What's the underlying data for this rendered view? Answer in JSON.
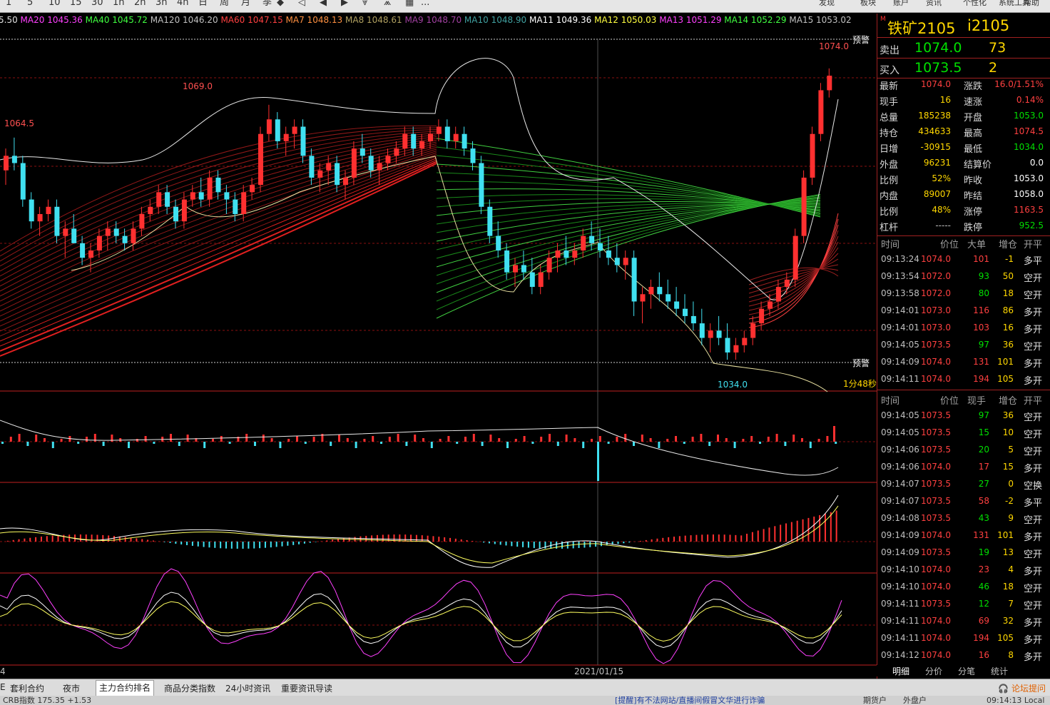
{
  "toolbar": {
    "periods": [
      "1",
      "5",
      "10",
      "15",
      "30",
      "1h",
      "2h",
      "3h",
      "4h",
      "日",
      "周",
      "月",
      "季"
    ],
    "menus": [
      "发现",
      "板块",
      "账户",
      "资讯",
      "个性化",
      "系统工具",
      "帮助"
    ],
    "more": "..."
  },
  "ma_legend": [
    {
      "label": "5.50",
      "color": "#e0e0e0"
    },
    {
      "label": "MA20",
      "value": "1045.36",
      "color": "#ff40ff"
    },
    {
      "label": "MA40",
      "value": "1045.72",
      "color": "#40ff40"
    },
    {
      "label": "MA120",
      "value": "1046.20",
      "color": "#c0c0c0"
    },
    {
      "label": "MA60",
      "value": "1047.15",
      "color": "#ff4040"
    },
    {
      "label": "MA7",
      "value": "1048.13",
      "color": "#ff9040"
    },
    {
      "label": "MA8",
      "value": "1048.61",
      "color": "#b0a060"
    },
    {
      "label": "MA9",
      "value": "1048.70",
      "color": "#a040a0"
    },
    {
      "label": "MA10",
      "value": "1048.90",
      "color": "#40a0a0"
    },
    {
      "label": "MA11",
      "value": "1049.36",
      "color": "#ffffff"
    },
    {
      "label": "MA12",
      "value": "1050.03",
      "color": "#ffff40"
    },
    {
      "label": "MA13",
      "value": "1051.29",
      "color": "#ff40ff"
    },
    {
      "label": "MA14",
      "value": "1052.29",
      "color": "#40ff40"
    },
    {
      "label": "MA15",
      "value": "1053.02",
      "color": "#c0c0c0"
    }
  ],
  "chart_labels": {
    "high_1064": "1064.5",
    "high_1069": "1069.0",
    "high_last": "1074.0",
    "low": "1034.0",
    "alert_top": "预警",
    "alert_bottom": "预警",
    "countdown": "1分48秒",
    "date": "2021/01/15",
    "left_axis_digit": "4"
  },
  "colors": {
    "up": "#ff3030",
    "down": "#40e0f0",
    "bg": "#000000",
    "grid": "#8a1010",
    "border": "#c02020",
    "gold": "#ffd700",
    "green": "#00e000",
    "white": "#ffffff"
  },
  "chart_data": {
    "type": "candlestick",
    "symbol": "铁矿2105",
    "ylim": [
      1030,
      1078
    ],
    "labeled_high": 1074.0,
    "labeled_low": 1034.0,
    "x_date_label": "2021/01/15",
    "candles": [
      [
        1060,
        1063,
        1058,
        1062
      ],
      [
        1062,
        1064.5,
        1060,
        1061
      ],
      [
        1061,
        1062,
        1055,
        1056
      ],
      [
        1056,
        1057,
        1052,
        1053
      ],
      [
        1053,
        1055,
        1051,
        1054
      ],
      [
        1054,
        1056,
        1053,
        1055
      ],
      [
        1055,
        1056,
        1050,
        1051
      ],
      [
        1051,
        1053,
        1048,
        1052
      ],
      [
        1052,
        1054,
        1050,
        1050
      ],
      [
        1050,
        1051,
        1047,
        1048
      ],
      [
        1048,
        1050,
        1046,
        1049
      ],
      [
        1049,
        1052,
        1048,
        1051
      ],
      [
        1051,
        1053,
        1049,
        1052
      ],
      [
        1052,
        1053,
        1050,
        1051
      ],
      [
        1051,
        1052,
        1049,
        1050
      ],
      [
        1050,
        1053,
        1049,
        1052
      ],
      [
        1052,
        1055,
        1051,
        1054
      ],
      [
        1054,
        1056,
        1053,
        1055
      ],
      [
        1055,
        1058,
        1054,
        1057
      ],
      [
        1057,
        1058,
        1054,
        1055
      ],
      [
        1055,
        1056,
        1052,
        1053
      ],
      [
        1053,
        1057,
        1052,
        1056
      ],
      [
        1056,
        1058,
        1055,
        1057
      ],
      [
        1057,
        1059,
        1055,
        1056
      ],
      [
        1056,
        1060,
        1055,
        1059
      ],
      [
        1059,
        1060,
        1056,
        1057
      ],
      [
        1057,
        1058,
        1054,
        1056
      ],
      [
        1056,
        1057,
        1053,
        1054
      ],
      [
        1054,
        1058,
        1053,
        1057
      ],
      [
        1057,
        1059,
        1056,
        1058
      ],
      [
        1058,
        1066,
        1057,
        1065
      ],
      [
        1065,
        1069,
        1064,
        1067
      ],
      [
        1067,
        1068,
        1063,
        1064
      ],
      [
        1064,
        1066,
        1062,
        1065
      ],
      [
        1065,
        1067,
        1063,
        1066
      ],
      [
        1066,
        1067,
        1061,
        1062
      ],
      [
        1062,
        1063,
        1058,
        1059
      ],
      [
        1059,
        1061,
        1057,
        1060
      ],
      [
        1060,
        1062,
        1058,
        1061
      ],
      [
        1061,
        1062,
        1057,
        1058
      ],
      [
        1058,
        1060,
        1056,
        1059
      ],
      [
        1059,
        1064,
        1058,
        1063
      ],
      [
        1063,
        1065,
        1061,
        1062
      ],
      [
        1062,
        1063,
        1059,
        1060
      ],
      [
        1060,
        1062,
        1058,
        1061
      ],
      [
        1061,
        1063,
        1060,
        1062
      ],
      [
        1062,
        1064,
        1061,
        1063
      ],
      [
        1063,
        1066,
        1062,
        1065
      ],
      [
        1065,
        1066,
        1062,
        1063
      ],
      [
        1063,
        1065,
        1062,
        1064
      ],
      [
        1064,
        1066,
        1063,
        1065
      ],
      [
        1065,
        1067,
        1064,
        1066
      ],
      [
        1066,
        1067,
        1063,
        1064
      ],
      [
        1064,
        1066,
        1063,
        1065
      ],
      [
        1065,
        1066,
        1062,
        1063
      ],
      [
        1063,
        1064,
        1060,
        1061
      ],
      [
        1061,
        1062,
        1054,
        1055
      ],
      [
        1055,
        1056,
        1050,
        1051
      ],
      [
        1051,
        1053,
        1048,
        1049
      ],
      [
        1049,
        1050,
        1045,
        1046
      ],
      [
        1046,
        1048,
        1044,
        1047
      ],
      [
        1047,
        1049,
        1045,
        1046
      ],
      [
        1046,
        1048,
        1043,
        1044
      ],
      [
        1044,
        1047,
        1043,
        1046
      ],
      [
        1046,
        1049,
        1045,
        1048
      ],
      [
        1048,
        1050,
        1046,
        1049
      ],
      [
        1049,
        1051,
        1047,
        1048
      ],
      [
        1048,
        1050,
        1047,
        1049
      ],
      [
        1049,
        1052,
        1048,
        1051
      ],
      [
        1051,
        1053,
        1049,
        1050
      ],
      [
        1050,
        1052,
        1048,
        1049
      ],
      [
        1049,
        1051,
        1047,
        1048
      ],
      [
        1048,
        1050,
        1046,
        1047
      ],
      [
        1047,
        1049,
        1045,
        1048
      ],
      [
        1048,
        1049,
        1040,
        1042
      ],
      [
        1042,
        1044,
        1039,
        1043
      ],
      [
        1043,
        1045,
        1041,
        1044
      ],
      [
        1044,
        1046,
        1042,
        1043
      ],
      [
        1043,
        1045,
        1041,
        1042
      ],
      [
        1042,
        1044,
        1040,
        1041
      ],
      [
        1041,
        1043,
        1039,
        1040
      ],
      [
        1040,
        1042,
        1038,
        1039
      ],
      [
        1039,
        1041,
        1036,
        1037
      ],
      [
        1037,
        1039,
        1035,
        1038
      ],
      [
        1038,
        1040,
        1036,
        1037
      ],
      [
        1037,
        1039,
        1034,
        1035
      ],
      [
        1035,
        1037,
        1034,
        1036
      ],
      [
        1036,
        1038,
        1035,
        1037
      ],
      [
        1037,
        1040,
        1036,
        1039
      ],
      [
        1039,
        1042,
        1038,
        1041
      ],
      [
        1041,
        1043,
        1040,
        1042
      ],
      [
        1042,
        1045,
        1041,
        1044
      ],
      [
        1044,
        1046,
        1043,
        1045
      ],
      [
        1045,
        1052,
        1044,
        1051
      ],
      [
        1051,
        1060,
        1050,
        1059
      ],
      [
        1059,
        1066,
        1058,
        1065
      ],
      [
        1065,
        1072,
        1064,
        1071
      ],
      [
        1071,
        1074,
        1070,
        1073
      ]
    ]
  },
  "quote": {
    "m": "M",
    "name": "铁矿2105",
    "code": "i2105",
    "sell_label": "卖出",
    "sell_price": "1074.0",
    "sell_vol": "73",
    "buy_label": "买入",
    "buy_price": "1073.5",
    "buy_vol": "2"
  },
  "stats": [
    {
      "l1": "最新",
      "v1": "1074.0",
      "c1": "#ff4040",
      "l2": "涨跌",
      "v2": "16.0/1.51%",
      "c2": "#ff4040"
    },
    {
      "l1": "现手",
      "v1": "16",
      "c1": "#ffd700",
      "l2": "速涨",
      "v2": "0.14%",
      "c2": "#ff4040"
    },
    {
      "l1": "总量",
      "v1": "185238",
      "c1": "#ffd700",
      "l2": "开盘",
      "v2": "1053.0",
      "c2": "#00e000"
    },
    {
      "l1": "持仓",
      "v1": "434633",
      "c1": "#ffd700",
      "l2": "最高",
      "v2": "1074.5",
      "c2": "#ff4040"
    },
    {
      "l1": "日增",
      "v1": "-30915",
      "c1": "#ffd700",
      "l2": "最低",
      "v2": "1034.0",
      "c2": "#00e000"
    },
    {
      "l1": "外盘",
      "v1": "96231",
      "c1": "#ffd700",
      "l2": "结算价",
      "v2": "0.0",
      "c2": "#ffffff"
    },
    {
      "l1": "比例",
      "v1": "52%",
      "c1": "#ffd700",
      "l2": "昨收",
      "v2": "1053.0",
      "c2": "#ffffff"
    },
    {
      "l1": "内盘",
      "v1": "89007",
      "c1": "#ffd700",
      "l2": "昨结",
      "v2": "1058.0",
      "c2": "#ffffff"
    },
    {
      "l1": "比例",
      "v1": "48%",
      "c1": "#ffd700",
      "l2": "涨停",
      "v2": "1163.5",
      "c2": "#ff4040"
    },
    {
      "l1": "杠杆",
      "v1": "-----",
      "c1": "#c0c0c0",
      "l2": "跌停",
      "v2": "952.5",
      "c2": "#00e000"
    }
  ],
  "ticks_header": {
    "time": "时间",
    "price": "价位",
    "size": "大单",
    "oi": "增仓",
    "type": "开平"
  },
  "ticks": [
    {
      "t": "09:13:24",
      "p": "1074.0",
      "s": "101",
      "o": "-1",
      "k": "多平"
    },
    {
      "t": "09:13:54",
      "p": "1072.0",
      "s": "93",
      "o": "50",
      "k": "空开"
    },
    {
      "t": "09:13:58",
      "p": "1072.0",
      "s": "80",
      "o": "18",
      "k": "空开"
    },
    {
      "t": "09:14:01",
      "p": "1073.0",
      "s": "116",
      "o": "86",
      "k": "多开"
    },
    {
      "t": "09:14:01",
      "p": "1073.0",
      "s": "103",
      "o": "16",
      "k": "多开"
    },
    {
      "t": "09:14:05",
      "p": "1073.5",
      "s": "97",
      "o": "36",
      "k": "空开"
    },
    {
      "t": "09:14:09",
      "p": "1074.0",
      "s": "131",
      "o": "101",
      "k": "多开"
    },
    {
      "t": "09:14:11",
      "p": "1074.0",
      "s": "194",
      "o": "105",
      "k": "多开"
    }
  ],
  "detail_header": {
    "time": "时间",
    "price": "价位",
    "size": "现手",
    "oi": "增仓",
    "type": "开平"
  },
  "details": [
    {
      "t": "09:14:05",
      "p": "1073.5",
      "s": "97",
      "o": "36",
      "k": "空开"
    },
    {
      "t": "09:14:05",
      "p": "1073.5",
      "s": "15",
      "o": "10",
      "k": "空开"
    },
    {
      "t": "09:14:06",
      "p": "1073.5",
      "s": "20",
      "o": "5",
      "k": "空开"
    },
    {
      "t": "09:14:06",
      "p": "1074.0",
      "s": "17",
      "o": "15",
      "k": "多开"
    },
    {
      "t": "09:14:07",
      "p": "1073.5",
      "s": "27",
      "o": "0",
      "k": "空换"
    },
    {
      "t": "09:14:07",
      "p": "1073.5",
      "s": "58",
      "o": "-2",
      "k": "多平"
    },
    {
      "t": "09:14:08",
      "p": "1073.5",
      "s": "43",
      "o": "9",
      "k": "空开"
    },
    {
      "t": "09:14:09",
      "p": "1074.0",
      "s": "131",
      "o": "101",
      "k": "多开"
    },
    {
      "t": "09:14:09",
      "p": "1073.5",
      "s": "19",
      "o": "13",
      "k": "空开"
    },
    {
      "t": "09:14:10",
      "p": "1074.0",
      "s": "23",
      "o": "4",
      "k": "多开"
    },
    {
      "t": "09:14:10",
      "p": "1074.0",
      "s": "46",
      "o": "18",
      "k": "空开"
    },
    {
      "t": "09:14:11",
      "p": "1073.5",
      "s": "12",
      "o": "7",
      "k": "空开"
    },
    {
      "t": "09:14:11",
      "p": "1074.0",
      "s": "69",
      "o": "32",
      "k": "多开"
    },
    {
      "t": "09:14:11",
      "p": "1074.0",
      "s": "194",
      "o": "105",
      "k": "多开"
    },
    {
      "t": "09:14:12",
      "p": "1074.0",
      "s": "16",
      "o": "8",
      "k": "多开"
    }
  ],
  "panel_tabs": [
    "明细",
    "分价",
    "分笔",
    "统计"
  ],
  "bottom_tabs": [
    {
      "label": "套利合约",
      "selected": false
    },
    {
      "label": "夜市",
      "selected": false
    },
    {
      "label": "主力合约排名",
      "selected": true
    },
    {
      "label": "商品分类指数",
      "selected": false
    },
    {
      "label": "24小时资讯",
      "selected": false
    },
    {
      "label": "重要资讯导读",
      "selected": false
    }
  ],
  "bottom_left": "E",
  "forum": "论坛提问",
  "status": {
    "index": "CRB指数  175.35  +1.53",
    "notice": "[提醒]有不法网站/直播间假冒文华进行诈骗",
    "b1": "期货户",
    "b2": "外盘户",
    "clock": "09:14:13 Local"
  }
}
